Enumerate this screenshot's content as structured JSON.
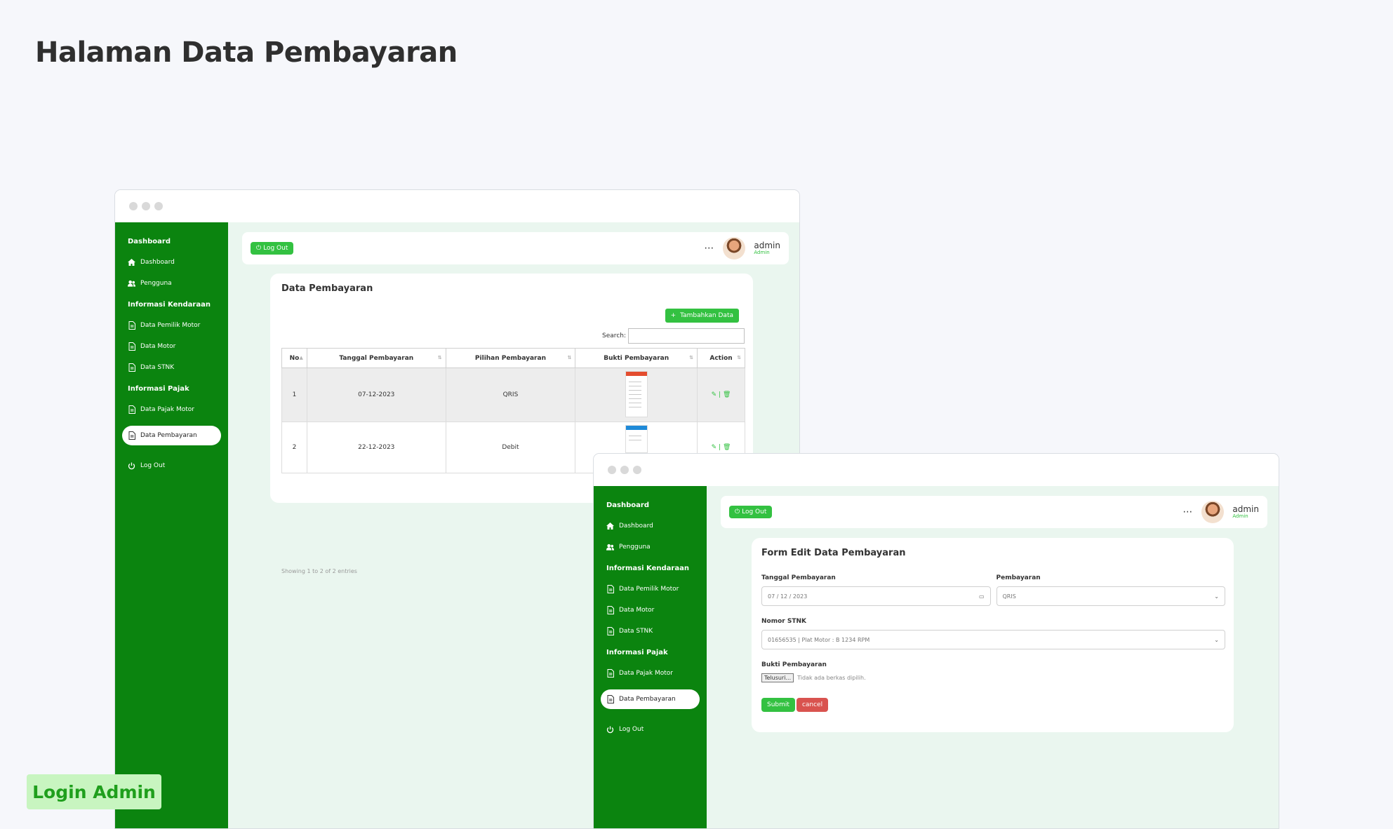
{
  "page_title": "Halaman Data Pembayaran",
  "login_badge": "Login Admin",
  "sidebar": {
    "section_dashboard": "Dashboard",
    "item_dashboard": "Dashboard",
    "item_pengguna": "Pengguna",
    "section_kendaraan": "Informasi Kendaraan",
    "item_pemilik": "Data Pemilik Motor",
    "item_motor": "Data Motor",
    "item_stnk": "Data STNK",
    "section_pajak": "Informasi Pajak",
    "item_pajak_motor": "Data Pajak Motor",
    "item_pembayaran": "Data Pembayaran",
    "item_logout": "Log Out"
  },
  "topbar": {
    "logout_label": "Log Out",
    "more_icon": "⋯",
    "user_name": "admin",
    "user_role": "Admin"
  },
  "list_view": {
    "title": "Data Pembayaran",
    "add_button": "Tambahkan Data",
    "search_label": "Search:",
    "columns": [
      "No",
      "Tanggal Pembayaran",
      "Pilihan Pembayaran",
      "Bukti Pembayaran",
      "Action"
    ],
    "rows": [
      {
        "no": "1",
        "tanggal": "07-12-2023",
        "pilihan": "QRIS",
        "action": "✎ | 🗑"
      },
      {
        "no": "2",
        "tanggal": "22-12-2023",
        "pilihan": "Debit",
        "action": "✎ | 🗑"
      }
    ],
    "entries_info": "Showing 1 to 2 of 2 entries"
  },
  "form_view": {
    "title": "Form Edit Data Pembayaran",
    "tanggal_label": "Tanggal Pembayaran",
    "tanggal_value": "07 / 12 / 2023",
    "pembayaran_label": "Pembayaran",
    "pembayaran_value": "QRIS",
    "stnk_label": "Nomor STNK",
    "stnk_value": "01656535 | Plat Motor : B 1234 RPM",
    "bukti_label": "Bukti Pembayaran",
    "file_button": "Telusuri...",
    "file_status": "Tidak ada berkas dipilih.",
    "submit_label": "Submit",
    "cancel_label": "cancel"
  },
  "colors": {
    "sidebar_green": "#0b840f",
    "accent_green": "#33c141",
    "danger": "#d9534f",
    "content_bg": "#eaf6ef"
  }
}
